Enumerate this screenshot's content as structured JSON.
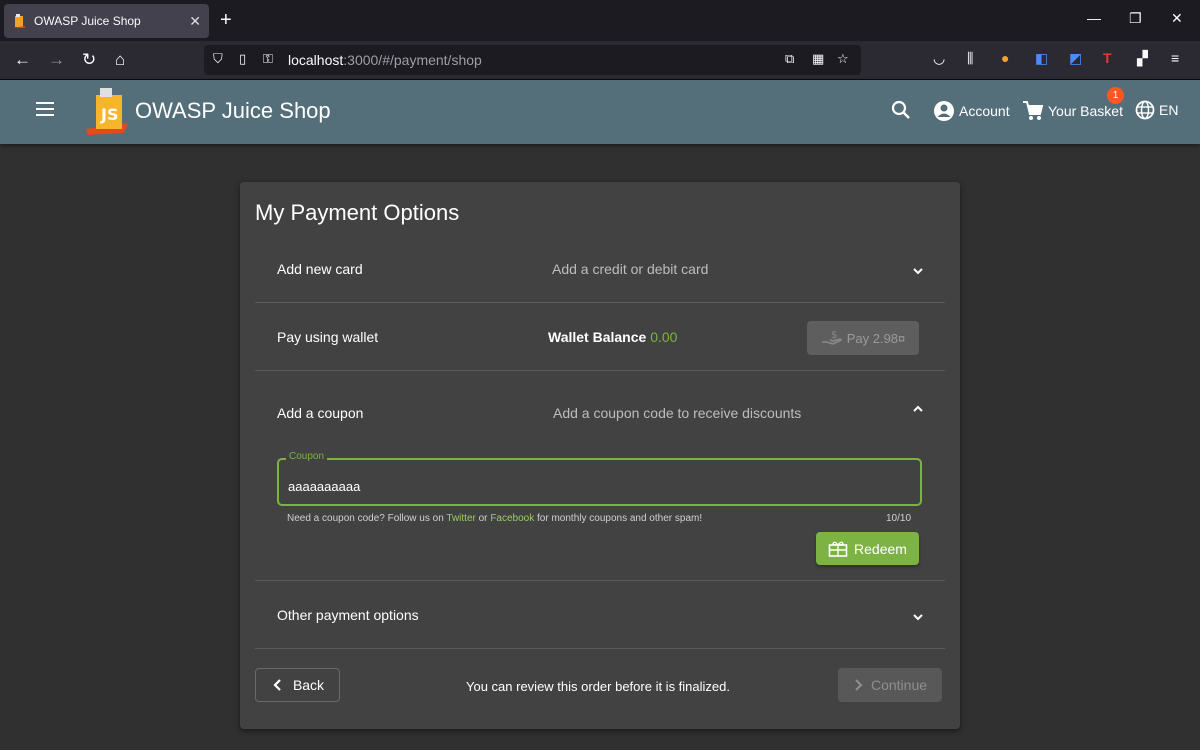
{
  "browser": {
    "tab_title": "OWASP Juice Shop",
    "tab_close": "✕",
    "new_tab": "+",
    "url_host": "localhost",
    "url_rest": ":3000/#/payment/shop"
  },
  "header": {
    "title": "OWASP Juice Shop",
    "account_label": "Account",
    "basket_label": "Your Basket",
    "basket_count": "1",
    "language": "EN"
  },
  "page": {
    "title": "My Payment Options",
    "add_card": {
      "title": "Add new card",
      "description": "Add a credit or debit card"
    },
    "wallet": {
      "title": "Pay using wallet",
      "balance_label": "Wallet Balance",
      "balance_value": "0.00",
      "pay_button": "Pay 2.98¤"
    },
    "coupon": {
      "title": "Add a coupon",
      "description": "Add a coupon code to receive discounts",
      "field_label": "Coupon",
      "field_value": "aaaaaaaaaa",
      "hint_prefix": "Need a coupon code? Follow us on",
      "hint_twitter": "Twitter",
      "hint_or": "or",
      "hint_facebook": "Facebook",
      "hint_suffix": "for monthly coupons and other spam!",
      "counter": "10/10",
      "redeem_button": "Redeem"
    },
    "other": {
      "title": "Other payment options"
    },
    "footer": {
      "back_button": "Back",
      "review_text": "You can review this order before it is finalized.",
      "continue_button": "Continue"
    }
  },
  "colors": {
    "accent": "#7cb342",
    "appbar": "#546e7a",
    "card": "#424242",
    "background": "#303030"
  }
}
